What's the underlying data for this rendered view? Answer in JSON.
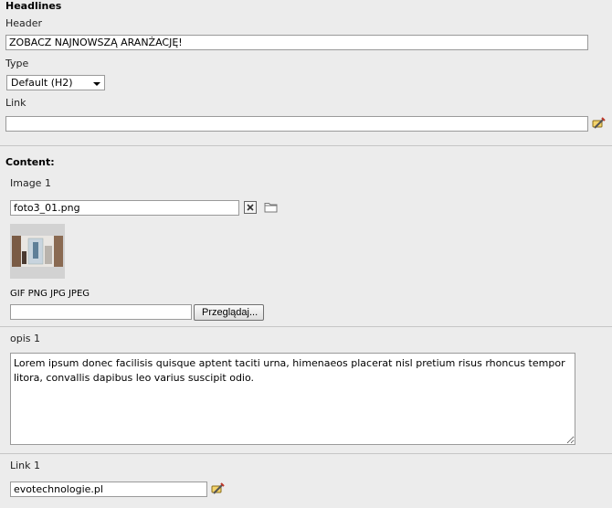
{
  "headlines": {
    "section_title": "Headlines",
    "header_label": "Header",
    "header_value": "ZOBACZ NAJNOWSZĄ ARANŻACJĘ!",
    "type_label": "Type",
    "type_value": "Default (H2)",
    "link_label": "Link",
    "link_value": ""
  },
  "content": {
    "section_title": "Content:",
    "image_label": "Image 1",
    "image_filename": "foto3_01.png",
    "allowed_types": "GIF PNG JPG JPEG",
    "upload_value": "",
    "browse_label": "Przeglądaj...",
    "desc_label": "opis 1",
    "desc_value": "Lorem ipsum donec facilisis quisque aptent taciti urna, himenaeos placerat nisl pretium risus rhoncus tempor litora, convallis dapibus leo varius suscipit odio.",
    "link1_label": "Link 1",
    "link1_value": "evotechnologie.pl"
  },
  "icons": {
    "link_wizard": "link-wizard-icon",
    "remove": "close-icon",
    "folder": "folder-icon"
  }
}
